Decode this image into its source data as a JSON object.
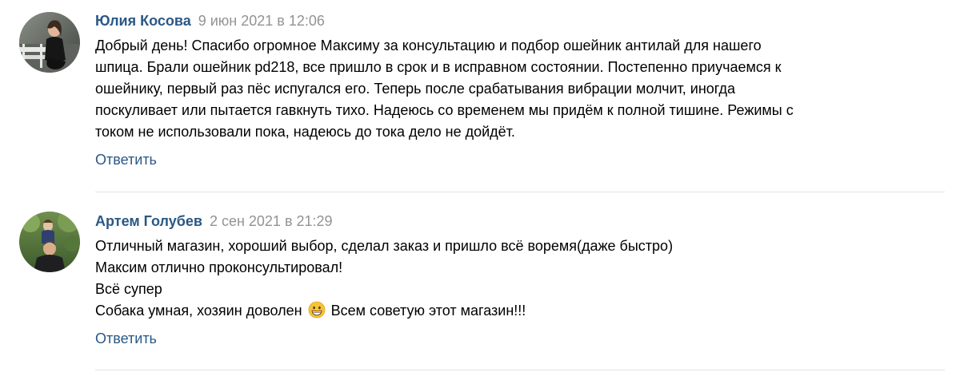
{
  "comments": [
    {
      "author": "Юлия Косова",
      "date": "9 июн 2021 в 12:06",
      "lines": [
        "Добрый день! Спасибо огромное Максиму за консультацию и подбор ошейник антилай для нашего",
        "шпица. Брали ошейник pd218, все пришло в срок и в исправном состоянии. Постепенно приучаемся к",
        "ошейнику, первый раз пёс испугался его. Теперь после срабатывания вибрации молчит, иногда",
        "поскуливает или пытается гавкнуть тихо. Надеюсь со временем мы придём к полной тишине. Режимы с",
        "током не использовали пока, надеюсь до тока дело не дойдёт."
      ],
      "reply_label": "Ответить"
    },
    {
      "author": "Артем Голубев",
      "date": "2 сен 2021 в 21:29",
      "lines": [
        "Отличный магазин, хороший выбор, сделал заказ и пришло всё воремя(даже быстро)",
        "Максим отлично проконсультировал!",
        "Всё супер"
      ],
      "last_line_before_emoji": "Собака умная, хозяин доволен",
      "emoji": "grinning-face-emoji",
      "last_line_after_emoji": "Всем советую этот магазин!!!",
      "reply_label": "Ответить"
    }
  ],
  "colors": {
    "author_link": "#2a5885",
    "date": "#939393",
    "divider": "#e1e3e6"
  }
}
